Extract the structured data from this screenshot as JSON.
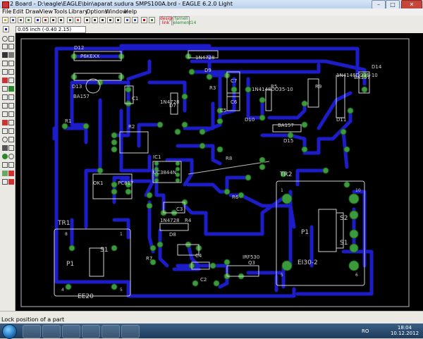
{
  "window": {
    "title": "2 Board - D:\\eagle\\EAGLE\\bin\\aparat sudura SMPS100A.brd - EAGLE 6.2.0 Light",
    "minimize": "–",
    "maximize": "□",
    "close": "✕"
  },
  "menu": [
    "File",
    "Edit",
    "Draw",
    "View",
    "Tools",
    "Library",
    "Options",
    "Window",
    "Help"
  ],
  "toolbar": {
    "logo1": "design\nlink",
    "logo2": "farnell\nelement14"
  },
  "coordinate_display": "0.05 inch (-0.40 2.15)",
  "status_message": "Lock position of a part",
  "taskbar": {
    "language": "RO",
    "time": "18:04",
    "date": "10.12.2012"
  },
  "colors": {
    "trace": "#1c1cc8",
    "pad": "#3b9a3b",
    "silk": "#d0d0d0",
    "canvas": "#000000"
  },
  "board": {
    "components": {
      "d12": "D12",
      "p6kexx": "P6KEXX",
      "d13": "D13",
      "ba157a": "BA157",
      "r1": "R1",
      "c1": "C1",
      "ic1": "IC1",
      "ok1": "OK1",
      "pc817": "PC817",
      "n1n4728a": "1N4728",
      "d9": "D9",
      "c7": "C7",
      "c6": "C6",
      "c5": "C5",
      "n1n4728b": "1N4728",
      "d7": "D7",
      "r3": "R3",
      "r9": "R9",
      "r5": "R5",
      "n1n4148a": "1N4148DO35-10",
      "d10": "D10",
      "ba157b": "BA157",
      "d15": "D15",
      "n1n4148b": "1N4148DO35-10",
      "d11": "D11",
      "ba157c": "BA157",
      "d14": "D14",
      "uc3844n": "UC3844N",
      "r2": "R2",
      "r8": "R8",
      "r6": "R6",
      "r4": "R4",
      "d8": "D8",
      "n1n4728c": "1N4728",
      "c4": "C4",
      "c2": "C2",
      "c3": "C3",
      "r7": "R7",
      "irf530": "IRF530",
      "q3": "Q3",
      "tr1": "TR1",
      "p1a": "P1",
      "s1a": "S1",
      "ee20": "EE20",
      "tr2": "TR2",
      "p1b": "P1",
      "s1b": "S1",
      "s2": "S2",
      "ei30": "EI30-2"
    },
    "pin_numbers": {
      "tr1_8": "8",
      "tr1_1": "1",
      "tr1_4": "4",
      "tr1_5": "5",
      "tr2_1": "1",
      "tr2_10": "10",
      "tr2_5": "5",
      "tr2_6": "6"
    }
  }
}
